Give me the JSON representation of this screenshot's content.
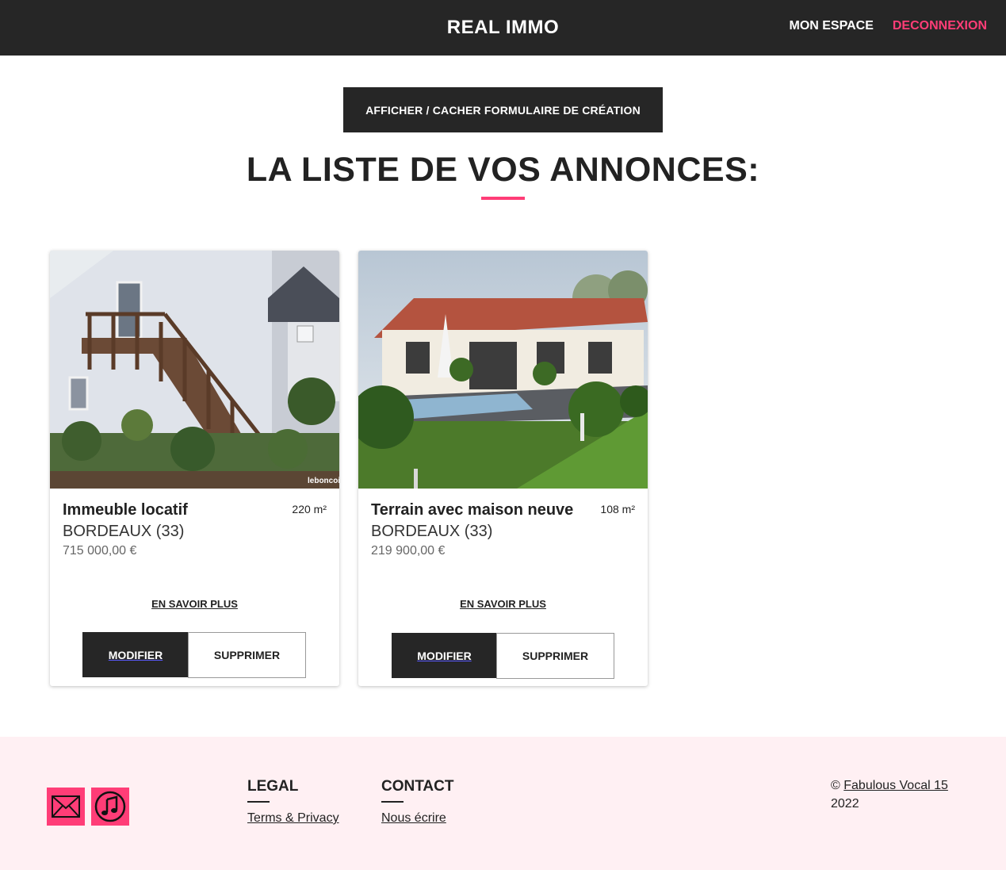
{
  "header": {
    "brand": "REAL IMMO",
    "nav": {
      "my_space": "MON ESPACE",
      "logout": "DECONNEXION"
    }
  },
  "toolbar": {
    "toggle_form_label": "AFFICHER / CACHER FORMULAIRE DE CRÉATION"
  },
  "page": {
    "title": "LA LISTE DE VOS ANNONCES:"
  },
  "listings": [
    {
      "title": "Immeuble locatif",
      "area": "220 m²",
      "city": "BORDEAUX (33)",
      "price": "715 000,00 €",
      "more_label": "EN SAVOIR PLUS",
      "edit_label": "MODIFIER",
      "delete_label": "SUPPRIMER",
      "image_watermark": "leboncoin"
    },
    {
      "title": "Terrain avec maison neuve",
      "area": "108 m²",
      "city": "BORDEAUX (33)",
      "price": "219 900,00 €",
      "more_label": "EN SAVOIR PLUS",
      "edit_label": "MODIFIER",
      "delete_label": "SUPPRIMER"
    }
  ],
  "footer": {
    "social_icons": [
      "envelope-icon",
      "music-note-icon"
    ],
    "legal": {
      "title": "LEGAL",
      "link": "Terms & Privacy"
    },
    "contact": {
      "title": "CONTACT",
      "link": "Nous écrire"
    },
    "copyright_symbol": "©",
    "copyright_name": "Fabulous Vocal 15",
    "copyright_year": "2022"
  },
  "colors": {
    "accent": "#ff3d77",
    "dark": "#262626",
    "footer_bg": "#fff0f3"
  }
}
